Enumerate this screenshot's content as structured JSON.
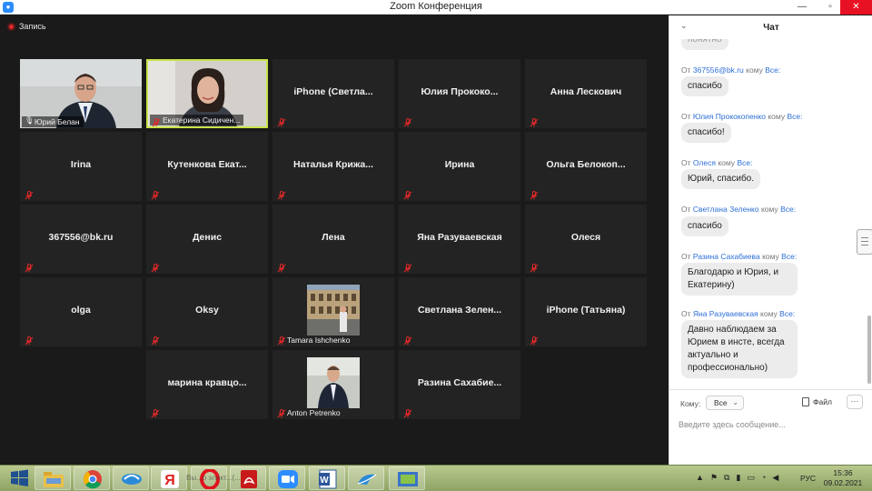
{
  "window": {
    "title": "Zoom Конференция",
    "min": "—",
    "max": "▫",
    "close": "✕"
  },
  "recording": {
    "label": "Запись"
  },
  "participants": [
    {
      "name": "Юрий Белан",
      "kind": "video-man"
    },
    {
      "name": "Екатерина Сидичен...",
      "kind": "video-woman",
      "active": true
    },
    {
      "name": "iPhone  (Светла..."
    },
    {
      "name": "Юлия  Прококо..."
    },
    {
      "name": "Анна Лескович"
    },
    {
      "name": "Irina"
    },
    {
      "name": "Кутенкова  Екат..."
    },
    {
      "name": "Наталья  Крижа..."
    },
    {
      "name": "Ирина"
    },
    {
      "name": "Ольга  Белокоп..."
    },
    {
      "name": "367556@bk.ru"
    },
    {
      "name": "Денис"
    },
    {
      "name": "Лена"
    },
    {
      "name": "Яна Разуваевская"
    },
    {
      "name": "Олеся"
    },
    {
      "name": "olga"
    },
    {
      "name": "Oksy"
    },
    {
      "name": "Tamara Ishchenko",
      "kind": "photo-city"
    },
    {
      "name": "Светлана  Зелен..."
    },
    {
      "name": "iPhone (Татьяна)"
    },
    {
      "name": "марина  кравцо..."
    },
    {
      "name": "Anton Petrenko",
      "kind": "photo-man"
    },
    {
      "name": "Разина  Сахабие..."
    }
  ],
  "chat": {
    "title": "Чат",
    "from_word": "От",
    "to_word": "кому",
    "to_all": "Все:",
    "partial_bubble": "понятно",
    "messages": [
      {
        "from": "367556@bk.ru",
        "text": "спасибо"
      },
      {
        "from": "Юлия Прококопенко",
        "text": "спасибо!"
      },
      {
        "from": "Олеся",
        "text": "Юрий, спасибо."
      },
      {
        "from": "Светлана Зеленко",
        "text": "спасибо"
      },
      {
        "from": "Разина Сахабиева",
        "text": "Благодарю и Юрия, и Екатерину)"
      },
      {
        "from": "Яна Разуваевская",
        "text": "Давно наблюдаем за Юрием в инсте, всегда актуально и профессионально)"
      }
    ],
    "composer": {
      "to_label": "Кому:",
      "to_value": "Все",
      "file_label": "Файл",
      "more_label": "···",
      "placeholder": "Введите здесь сообщение..."
    }
  },
  "taskbar": {
    "ghost_text": "Вы...о элект...(...",
    "tray_icons": [
      "chevron-up-icon",
      "flag-icon",
      "network-icon",
      "signal-icon",
      "battery-icon",
      "wifi-icon",
      "volume-icon"
    ],
    "language": "РУС",
    "time": "15:36",
    "date": "09.02.2021"
  },
  "colors": {
    "zoom_blue": "#2d8cff",
    "active_speaker": "#c7e34a",
    "mute_red": "#e02828",
    "link_blue": "#2d6fd6"
  }
}
